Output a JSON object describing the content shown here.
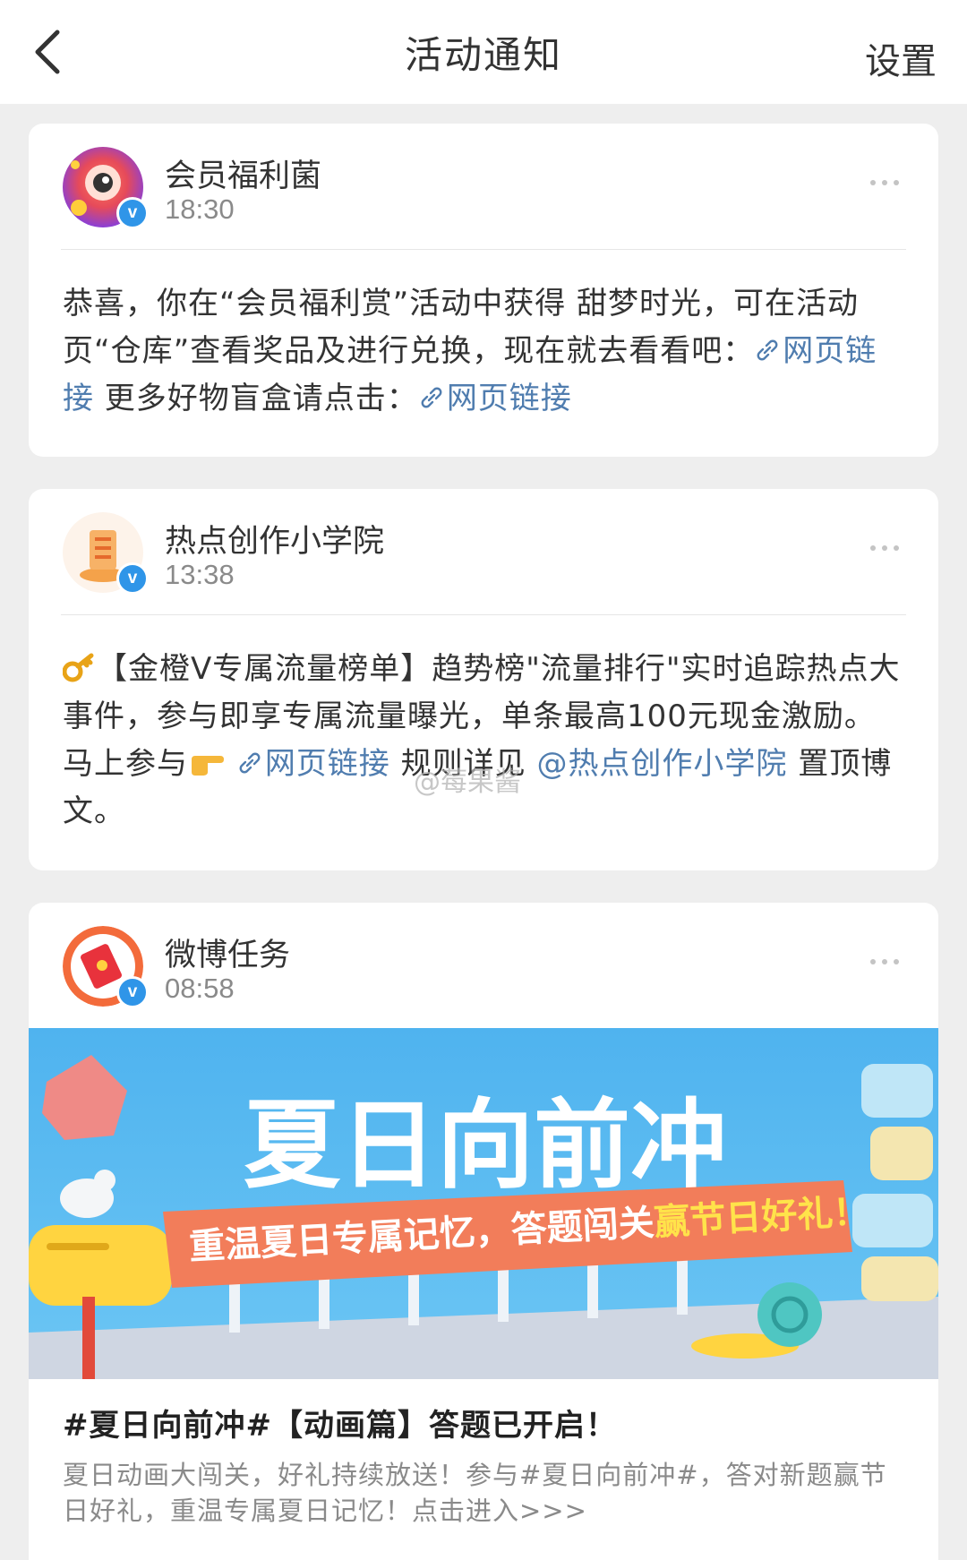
{
  "nav": {
    "title": "活动通知",
    "settings_label": "设置",
    "back_icon": "chevron-left-icon"
  },
  "cards": [
    {
      "sender": "会员福利菌",
      "time": "18:30",
      "verified": "v",
      "segments": [
        "恭喜，你在“会员福利赏”活动中获得 甜梦时光，可在活动页“仓库”查看奖品及进行兑换，现在就去看看吧：",
        "网页链接",
        " 更多好物盲盒请点击：",
        "网页链接"
      ]
    },
    {
      "sender": "热点创作小学院",
      "time": "13:38",
      "verified": "v",
      "segments": [
        "【金橙V专属流量榜单】趋势榜\"流量排行\"实时追踪热点大事件，参与即享专属流量曝光，单条最高100元现金激励。马上参与",
        "网页链接",
        " 规则详见 ",
        "@热点创作小学院",
        " 置顶博文。"
      ]
    },
    {
      "sender": "微博任务",
      "time": "08:58",
      "verified": "v",
      "banner": {
        "headline": "夏日向前冲",
        "subline_a": "重温夏日专属记忆，答题闯关",
        "subline_b": "赢节日好礼！"
      },
      "post_title": "#夏日向前冲#【动画篇】答题已开启！",
      "post_desc": "夏日动画大闯关，好礼持续放送！参与#夏日向前冲#，答对新题赢节日好礼，重温专属夏日记忆！点击进入>>>"
    }
  ],
  "watermark": "@莓果酱",
  "colors": {
    "link": "#507daf",
    "verified_badge": "#2f95e8",
    "banner_sky": "#5bb8f0",
    "banner_ribbon": "#f27d5a"
  }
}
